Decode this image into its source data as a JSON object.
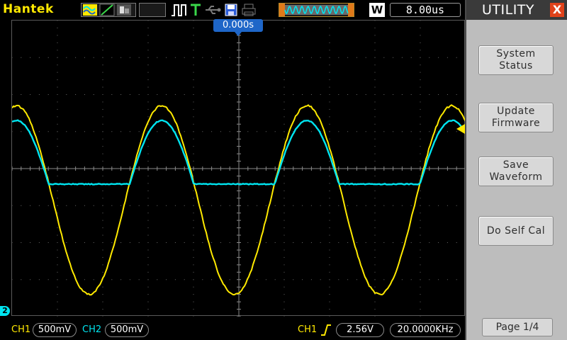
{
  "topbar": {
    "brand": "Hantek",
    "timebase": "8.00us",
    "mode": "W",
    "icons": [
      "waveform-display-icon",
      "line-draw-icon",
      "persist-icon",
      "pulse-trigger-icon",
      "trigger-t-icon",
      "usb-icon",
      "save-disk-icon",
      "printer-icon",
      "memory-depth-icon"
    ]
  },
  "screen": {
    "trigger_position": "0.000s",
    "ch2_marker": "2"
  },
  "bottombar": {
    "ch1_label": "CH1",
    "ch1_scale": "500mV",
    "ch2_label": "CH2",
    "ch2_scale": "500mV",
    "trig_source": "CH1",
    "trig_level": "2.56V",
    "frequency": "20.0000KHz"
  },
  "menu": {
    "title": "UTILITY",
    "close_label": "X",
    "buttons": [
      {
        "label": "System\nStatus"
      },
      {
        "label": "Update\nFirmware"
      },
      {
        "label": "Save\nWaveform"
      },
      {
        "label": "Do Self Cal"
      }
    ],
    "page": "Page 1/4"
  },
  "colors": {
    "ch1": "#ffe900",
    "ch2": "#00e5f0",
    "accent": "#1e66c8",
    "close": "#e0421a"
  },
  "waveform": {
    "ch1": {
      "period_divs": 3.2,
      "amplitude_divs": 2.55,
      "offset_divs": 1.7,
      "phase_divs": 1.7
    },
    "ch2": {
      "period_divs": 3.2,
      "amplitude_divs": 2.1,
      "offset_divs": 1.3,
      "phase_divs": 1.7,
      "floor_divs": -0.42
    }
  }
}
